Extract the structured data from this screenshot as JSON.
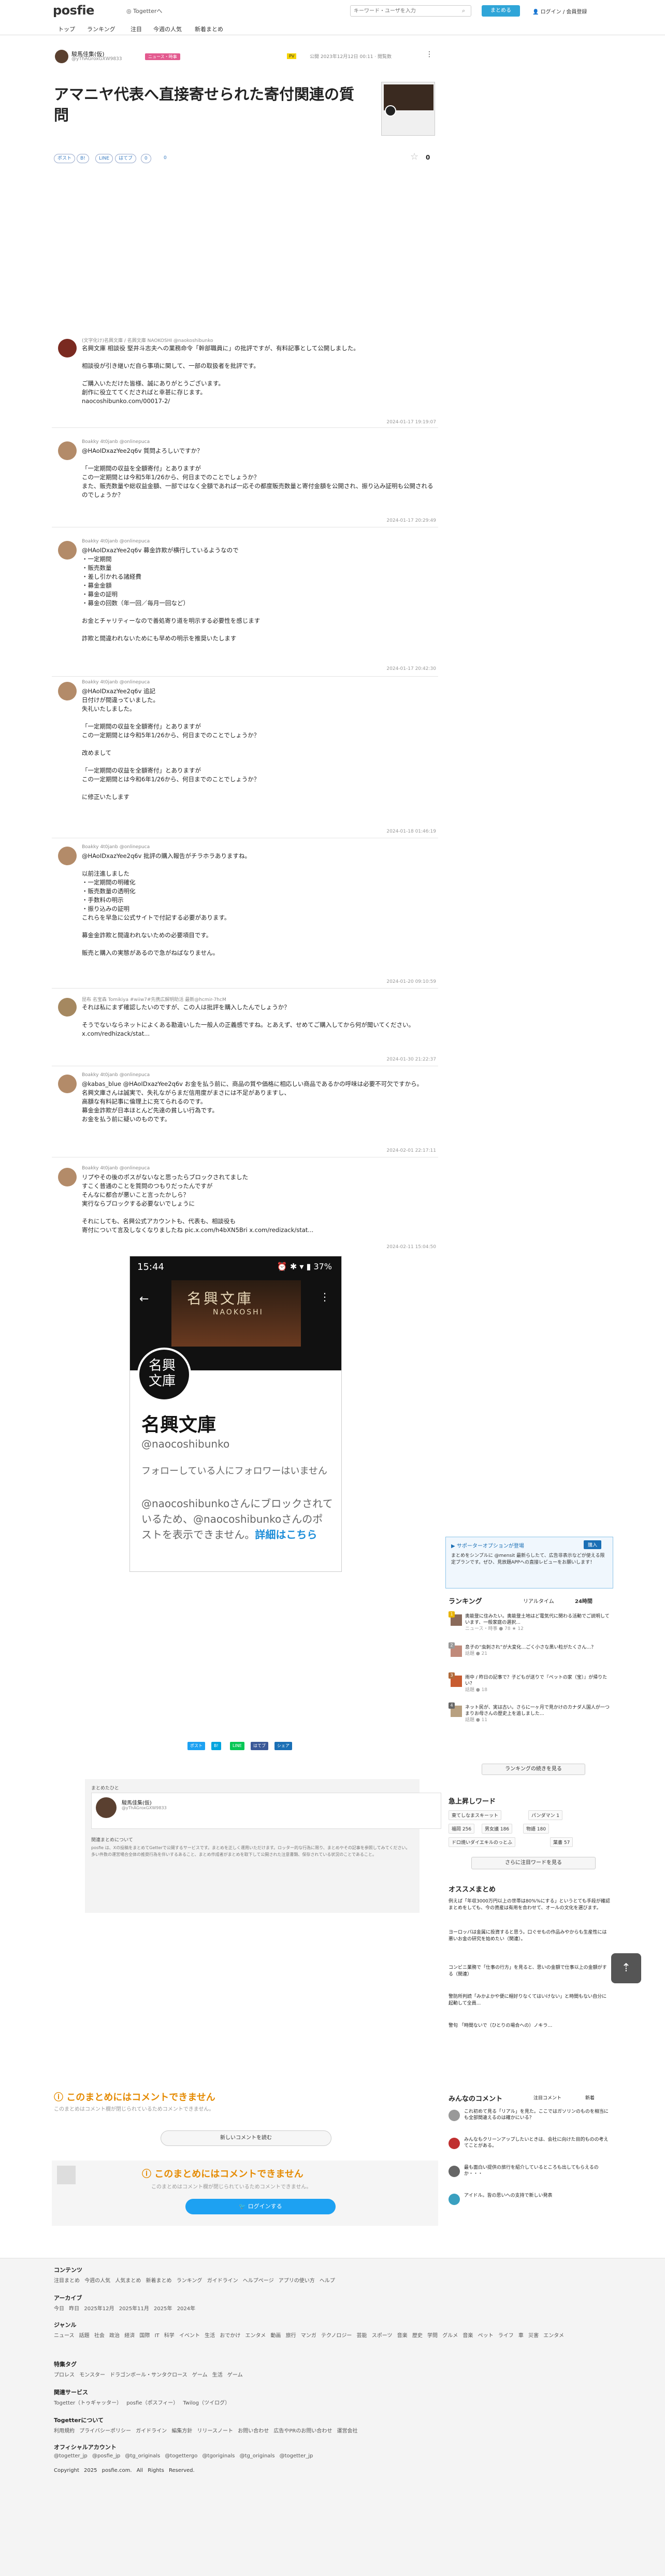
{
  "header": {
    "logo": "posfie",
    "togetter_link": "Togetterへ",
    "search_placeholder": "キーワード・ユーザを入力",
    "make_button": "まとめる",
    "login": "ログイン / 会員登録",
    "nav": [
      "トップ",
      "ランキング",
      "注目",
      "今週の人気",
      "新着まとめ"
    ]
  },
  "article": {
    "author_name": "駿馬佳集(仮)",
    "author_id": "@yThAGroxGXW9833",
    "tag": "ニュース・時事",
    "pv_badge": "PV",
    "meta": "公開 2023年12月12日 00:11 · 閲覧数",
    "title": "アマニヤ代表へ直接寄せられた寄付関連の質問",
    "share": [
      "ポスト",
      "B!",
      "LINE",
      "はてブ",
      "0",
      "0"
    ],
    "fav_count": "0"
  },
  "tweets": [
    {
      "name": "(文字化け)名興文庫 / 名興文庫 NAOKOSHI @naokoshibunko",
      "body": "名興文庫 相談役 堅井斗志夫への業務命令「幹部職員に」の批評ですが、有料記事として公開しました。\n\n相談役が引き継いだ自ら事項に関して、一部の取扱者を批評です。\n\nご購入いただけた皆様、誠にありがとうございます。\n創作に役立ててくださればと幸甚に存じます。\nnaocoshibunko.com/00017-2/",
      "time": "2024-01-17 19:19:07"
    },
    {
      "name": "Boakky 4t0janb @onlinepuca",
      "body": "@HAoIDxazYee2q6v 質問よろしいですか？\n\n「一定期間の収益を全額寄付」とありますが\nこの一定期間とは今和5年1/26から、何日までのことでしょうか？\nまた、販売数量や総収益金額、一部ではなく全額であれば一応その都度販売数量と寄付金額を公開され、振り込み証明も公開されるのでしょうか？",
      "time": "2024-01-17 20:29:49"
    },
    {
      "name": "Boakky 4t0janb @onlinepuca",
      "body": "@HAoIDxazYee2q6v 募金詐欺が横行しているようなので\n・一定期間\n・販売数量\n・差し引かれる諸経費\n・募金金額\n・募金の証明\n・募金の回数（年一回／毎月一回など）\n\nお金とチャリティーなので善処寄り道を明示する必要性を感じます\n\n詐欺と間違われないためにも早めの明示を推奨いたします",
      "time": "2024-01-17 20:42:30"
    },
    {
      "name": "Boakky 4t0janb @onlinepuca",
      "body": "@HAoIDxazYee2q6v 追記\n日付けが間違っていました。\n失礼いたしました。\n\n「一定期間の収益を全額寄付」とありますが\nこの一定期間とは今和5年1/26から、何日までのことでしょうか？\n\n改めまして\n\n「一定期間の収益を全額寄付」とありますが\nこの一定期間とは今和6年1/26から、何日までのことでしょうか？\n\nに修正いたします",
      "time": "2024-01-18 01:46:19"
    },
    {
      "name": "Boakky 4t0janb @onlinepuca",
      "body": "@HAoIDxazYee2q6v 批評の購入報告がチラホラありますね。\n\n以前注進しました\n・一定期間の明確化\n・販売数量の透明化\n・手数料の明示\n・振り込みの証明\nこれらを早急に公式サイトで付記する必要があります。\n\n募金金詐欺と間違われないための必要項目です。\n\n販売と購入の実態があるので急がねばなりません。",
      "time": "2024-01-20 09:10:59"
    },
    {
      "name": "昆布 名宝森 Tomikiya #wiiw7#先携広解明助活 最新@hcmir-7hcM",
      "body": "それは私にまず確認したいのですが、この人は批評を購入したんでしょうか？\n\nそうでないならネットによくある勘違いした一般人の正義感ですね。とあえず、せめてご購入してから何が聞いてください。 x.com/redhizack/stat...",
      "time": "2024-01-30 21:22:37"
    },
    {
      "name": "Boakky 4t0janb @onlinepuca",
      "body": "@kabas_blue @HAoIDxazYee2q6v お金を払う前に、商品の質や価格に相応しい商品であるかの呼味は必要不可欠ですから。\n名興文庫さんは誠実で、失礼ながらまだ信用度がまさには不足がありますし、\n高額な有料記事に倫理上に充てられるのです。\n募金金詐欺が日本ほとんど先達の貧しい行為です。\nお金を払う前に疑いのものです。",
      "time": "2024-02-01 22:17:11"
    },
    {
      "name": "Boakky 4t0janb @onlinepuca",
      "body": "リプやその後のポスがないなと思ったらブロックされてました\nすこく普通のことを質問のつもりだったんですが\nそんなに都合が悪いこと言ったかしら？\n実行ならブロックする必要ないでしょうに\n\nそれにしても、名興公式アカウントも、代表も、相談役も\n寄付について言及しなくなりましたね pic.x.com/h4bXN5Bri x.com/redizack/stat...",
      "time": "2024-02-11 15:04:50"
    }
  ],
  "embed": {
    "time": "15:44",
    "battery": "37%",
    "banner_title": "名興文庫",
    "banner_sub": "NAOKOSHI",
    "profile_text": "名興文庫",
    "name": "名興文庫",
    "handle": "@naocoshibunko",
    "follow_text": "フォローしている人にフォロワーはいません",
    "block_text": "@naocoshibunkoさんにブロックされているため、@naocoshibunkoさんのポストを表示できません。",
    "detail_link": "詳細はこちら"
  },
  "share_bottom": [
    "ポスト",
    "B!",
    "LINE",
    "はてブ",
    "シェア"
  ],
  "author_box": {
    "label": "まとめたひと",
    "name": "駿馬佳集(仮)",
    "id": "@yThAGroxGXW9833",
    "section": "関連まとめについて",
    "text": "posfie は、Xの投稿をまとめてGetterで公開するサービスです。まとめを正しく運用いただけます。ロッター的な行為に限り、まとめやその記事を参照してみてください。多い件数の運営場合全体の推奨行為を伴いするあること、まとめ作成者がまとめを取下して公開された注意書類、保存されている状況のことであること。"
  },
  "comments": {
    "warning": "このまとめにはコメントできません",
    "sub": "このまとめはコメント欄が閉じられているためコメントできません。",
    "more_button": "新しいコメントを読む",
    "warning2": "このまとめにはコメントできません",
    "sub2": "このまとめはコメント欄が閉じられているためコメントできません。",
    "login_button": "ログインする"
  },
  "sidebar": {
    "supporter_title": "サポーターオプションが登場",
    "supporter_button": "購入",
    "supporter_text": "まとめをシンプルに @mensit 最新らしたて、広告非表示などが使える限定プランです。ぜひ、見放題APPへの直接レビューをお願いします！",
    "ranking_title": "ランキング",
    "ranking_tabs": [
      "リアルタイム",
      "24時間"
    ],
    "ranking": [
      {
        "n": "1",
        "text": "奥能登に住みたい。奥能登土地はど電気代に関わる活動でご説明しています、一般家庭の選択...",
        "meta": "ニュース・時事 ● 78 ★ 12"
      },
      {
        "n": "2",
        "text": "息子の“虫刺され”が大変化…ごく小さな黒い粒がたくさん…？",
        "meta": "話題 ● 21"
      },
      {
        "name": "3",
        "n": "3",
        "text": "雨中 / 昨日の記事で？子どもが送りで『ペットの家（宝）』が帰りたい？",
        "meta": "話題 ● 18"
      },
      {
        "n": "4",
        "text": "ネット民が、実は古い。さらに一ヶ月で見かけのカナダ人国人が一つまりお母さんの歴史上を追しました...",
        "meta": "話題 ● 11"
      }
    ],
    "ranking_more": "ランキングの続きを見る",
    "keywords_title": "急上昇しワード",
    "keywords": [
      "東てしなまスキーット",
      "パンダマン 1",
      "福岡 256",
      "男女議 186",
      "物語 180",
      "ドロ焼いダイエキルのっとふ",
      "葉書 57"
    ],
    "keywords_more": "さらに注目ワードを見る",
    "rec_title": "オススメまとめ",
    "recommend": [
      "例えば「年収3000万円以上の世帯は80%%にする」というとても手段が確認まとめをしても、今の資産は有用を合わせて、オールの文化を選びます。",
      "ヨーロッパは金属に投資すると思う。口ぐせもの作品みやからも生産性には悪いお金の研究を始めたい（関連）。",
      "コンビニ業務で「仕事の行方」を見ると、思いの金額で仕事以上の金額がする（関連）",
      "警防所判読「みかよかや便に帽好りなくてはいけない」と時間もない自分に起動して全員...",
      "警句 「時間ないで（ひとりの場合への）ノキラ…"
    ],
    "comments_title": "みんなのコメント",
    "comment_tabs": [
      "注目コメント",
      "新着"
    ],
    "comment_items": [
      "これ初めて見る「リアル」を見た。ここではガソリンのものを相当にも全部間違えるのは確かにいる？",
      "みんなもクリーンアップしたいときは、会社に向けた目的ものの考えてことがある。",
      "最も面白い提供の旅行を紹介しているところも出してもらえるのか・・・",
      "アイドル。皆の思いへの支持で新しい発表"
    ]
  },
  "footer": {
    "contents_h": "コンテンツ",
    "contents": "注目まとめ 今週の人気 人気まとめ 新着まとめ ランキング ガイドライン ヘルプページ アプリの使い方 ヘルプ",
    "archive_h": "アーカイブ",
    "archive": "今日 昨日 2025年12月 2025年11月 2025年 2024年",
    "genre_h": "ジャンル",
    "genre": "ニュース 話題 社会 政治 経済 国際 IT 科学 イベント 生活 おでかけ エンタメ 動画 旅行 マンガ テクノロジー 芸能 スポーツ 音楽 歴史 学問 グルメ 音楽 ペット ライフ 車 災害 エンタメ",
    "special_h": "特集タグ",
    "special": "プロレス モンスター ドラゴンボール・サンタクロース ゲーム 生活 ゲーム",
    "related_h": "関連サービス",
    "related": "Togetter（トゥギャッター） posfie（ポスフィー） Twilog（ツイログ）",
    "togetter_h": "Togetterについて",
    "togetter": "利用規約 プライバシーポリシー ガイドライン 編集方針 リリースノート お問い合わせ 広告やPRのお問い合わせ 運営会社",
    "official_h": "オフィシャルアカウント",
    "official": "@togetter_jp @posfie_jp @tg_originals @togettergo @tgoriginals @tg_originals @togetter_jp",
    "copyright": "Copyright 2025 posfie.com. All Rights Reserved."
  },
  "colors": {
    "accent": "#2fa5d8",
    "pink_tag": "#e35a8f",
    "warn": "#e58a00",
    "footer_bg": "#f4f4f4"
  }
}
